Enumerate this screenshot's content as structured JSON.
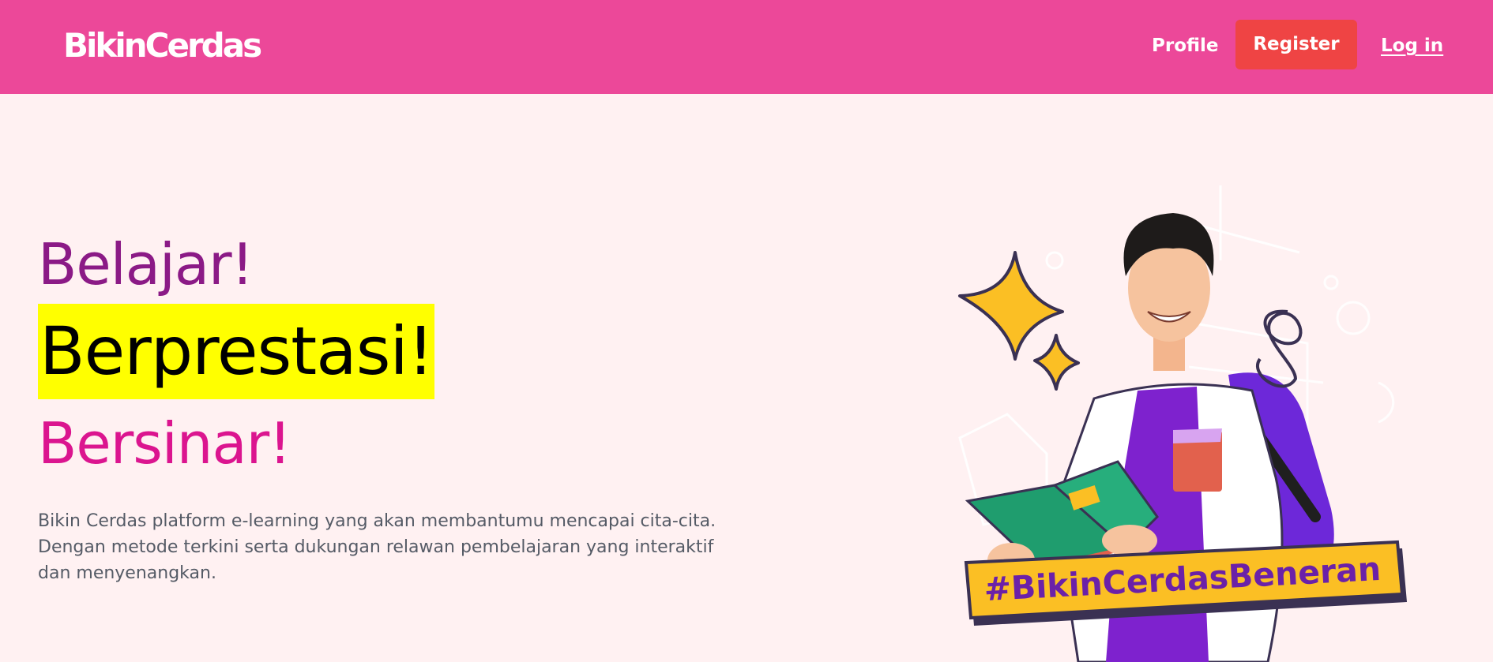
{
  "navbar": {
    "brand": "BikinCerdas",
    "profile_label": "Profile",
    "register_label": "Register",
    "login_label": "Log in"
  },
  "hero": {
    "line1": "Belajar!",
    "line2": "Berprestasi!",
    "line3": "Bersinar!",
    "description_lines": [
      "Bikin Cerdas platform e-learning yang akan membantumu mencapai cita-cita.",
      "Dengan metode terkini serta dukungan relawan pembelajaran yang interaktif",
      "dan menyenangkan."
    ]
  },
  "illustration": {
    "hashtag": "#BikinCerdasBeneran",
    "icon": "student-with-book-illustration"
  },
  "colors": {
    "navbar_bg": "#ec4899",
    "register_bg": "#ef4444",
    "page_bg": "#fff1f2",
    "line1_color": "#8b1a86",
    "line2_highlight": "#ffff00",
    "line3_color": "#db158f",
    "hashtag_bg": "#fbbf24",
    "hashtag_text": "#6b21a8"
  }
}
